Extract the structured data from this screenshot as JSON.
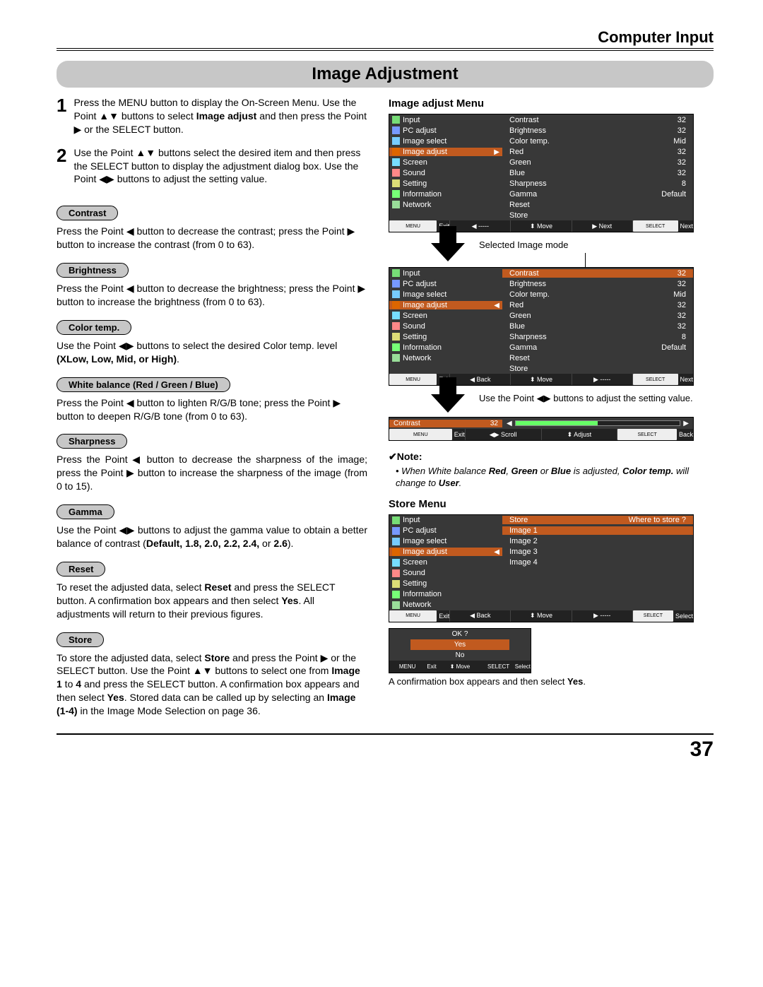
{
  "header": "Computer Input",
  "title": "Image Adjustment",
  "pageNumber": "37",
  "steps": {
    "s1_num": "1",
    "s1_a": "Press the MENU button to display the On-Screen Menu. Use the Point ▲▼ buttons to select ",
    "s1_b": "Image adjust",
    "s1_c": " and then press the Point ▶ or the SELECT button.",
    "s2_num": "2",
    "s2": "Use the Point ▲▼ buttons select the desired item and then press the SELECT button to display the adjustment dialog box. Use the Point ◀▶ buttons to adjust the setting value."
  },
  "pills": {
    "contrast": "Contrast",
    "brightness": "Brightness",
    "colortemp": "Color temp.",
    "wb": "White balance (Red / Green / Blue)",
    "sharpness": "Sharpness",
    "gamma": "Gamma",
    "reset": "Reset",
    "store": "Store"
  },
  "paras": {
    "contrast": "Press the Point ◀ button to decrease the contrast; press the Point ▶ button to increase the contrast (from 0 to 63).",
    "brightness": "Press the Point ◀ button to decrease the brightness; press the Point ▶ button to increase the brightness (from 0 to 63).",
    "colortemp_a": "Use the Point ◀▶ buttons to select the desired Color temp. level ",
    "colortemp_b": "(XLow, Low, Mid, or High)",
    "colortemp_c": ".",
    "wb": "Press the Point ◀ button to lighten R/G/B tone; press the Point ▶ button to deepen R/G/B tone (from 0 to 63).",
    "sharpness": "Press the Point ◀ button to decrease the sharpness of the image; press the Point ▶ button to increase the sharpness of the image (from 0 to 15).",
    "gamma_a": "Use the Point ◀▶ buttons to adjust the gamma value to obtain a better balance of contrast (",
    "gamma_b": "Default, 1.8, 2.0, 2.2, 2.4,",
    "gamma_c": " or ",
    "gamma_d": "2.6",
    "gamma_e": ").",
    "reset_a": "To reset the adjusted data, select ",
    "reset_b": "Reset",
    "reset_c": " and press the SELECT button. A confirmation box appears and then select ",
    "reset_d": "Yes",
    "reset_e": ". All adjustments will return to their previous figures.",
    "store_a": "To store the adjusted data, select ",
    "store_b": "Store",
    "store_c": " and press the Point ▶ or the SELECT button. Use the Point ▲▼ buttons to select one from ",
    "store_d": "Image 1",
    "store_e": " to ",
    "store_f": "4",
    "store_g": " and press the SELECT button. A confirmation box appears and then select ",
    "store_h": "Yes",
    "store_i": ". Stored data can be called up by selecting an ",
    "store_j": "Image (1-4)",
    "store_k": " in the Image Mode Selection on page 36."
  },
  "right": {
    "heading1": "Image adjust Menu",
    "selectedLabel": "Selected Image mode",
    "useLabel": "Use the Point ◀▶ buttons to adjust the setting value.",
    "noteHead": "✔Note:",
    "note_a": "When White balance ",
    "note_b": "Red",
    "note_c": ", ",
    "note_d": "Green",
    "note_e": " or ",
    "note_f": "Blue",
    "note_g": " is adjusted, ",
    "note_h": "Color temp.",
    "note_i": " will change to ",
    "note_j": "User",
    "note_k": ".",
    "heading2": "Store Menu",
    "confirm_a": "A confirmation box appears and then select ",
    "confirm_b": "Yes",
    "confirm_c": "."
  },
  "osd": {
    "leftMenu": [
      "Input",
      "PC adjust",
      "Image select",
      "Image adjust",
      "Screen",
      "Sound",
      "Setting",
      "Information",
      "Network"
    ],
    "icons": [
      "#7d7",
      "#79f",
      "#7cf",
      "#d60",
      "#7df",
      "#f88",
      "#dd7",
      "#7f7",
      "#9d9"
    ],
    "menu1_right": [
      {
        "k": "Contrast",
        "v": "32"
      },
      {
        "k": "Brightness",
        "v": "32"
      },
      {
        "k": "Color temp.",
        "v": "Mid"
      },
      {
        "k": "Red",
        "v": "32"
      },
      {
        "k": "Green",
        "v": "32"
      },
      {
        "k": "Blue",
        "v": "32"
      },
      {
        "k": "Sharpness",
        "v": "8"
      },
      {
        "k": "Gamma",
        "v": "Default"
      },
      {
        "k": "Reset",
        "v": ""
      },
      {
        "k": "Store",
        "v": ""
      }
    ],
    "footer_menu": "MENU",
    "footer_select": "SELECT",
    "footer1": [
      "Exit",
      "-----",
      "Move",
      "Next",
      "Next"
    ],
    "footer2": [
      "Exit",
      "Back",
      "Move",
      "-----",
      "Next"
    ],
    "footerSlider": [
      "Exit",
      "Scroll",
      "Adjust",
      "Back"
    ],
    "slider": {
      "label": "Contrast",
      "value": "32"
    },
    "storeHeader": {
      "k": "Store",
      "v": "Where to store ?"
    },
    "storeItems": [
      "Image 1",
      "Image 2",
      "Image 3",
      "Image 4"
    ],
    "footerStore": [
      "Exit",
      "Back",
      "Move",
      "-----",
      "Select"
    ],
    "ok": {
      "title": "OK ?",
      "yes": "Yes",
      "no": "No"
    },
    "okFooter": [
      "Exit",
      "Move",
      "Select"
    ]
  }
}
